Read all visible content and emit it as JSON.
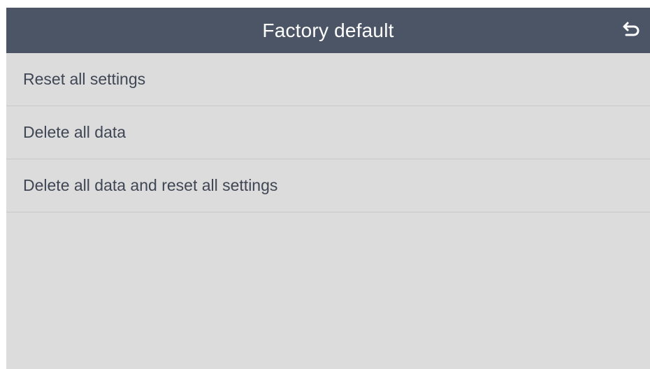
{
  "header": {
    "title": "Factory default",
    "back_icon": "back-arrow-icon"
  },
  "menu": {
    "items": [
      {
        "label": "Reset all settings"
      },
      {
        "label": "Delete all data"
      },
      {
        "label": "Delete all data and reset all settings"
      }
    ]
  },
  "colors": {
    "header_bg": "#4b5566",
    "screen_bg": "#dcdcdc",
    "text": "#3f4654"
  }
}
